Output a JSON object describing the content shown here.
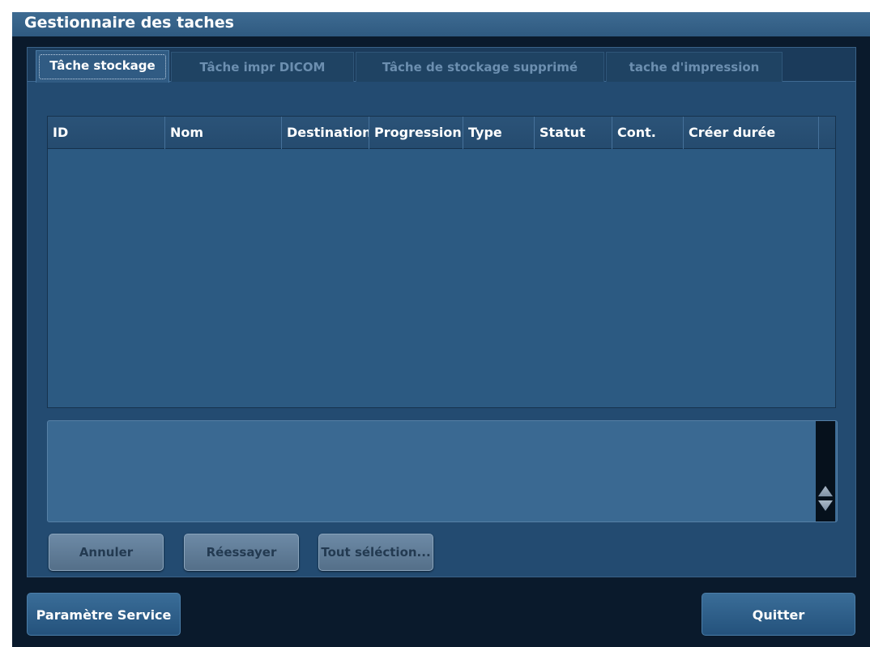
{
  "window": {
    "title": "Gestionnaire des taches"
  },
  "tabs": [
    {
      "label": "Tâche stockage",
      "active": true
    },
    {
      "label": "Tâche impr DICOM",
      "active": false
    },
    {
      "label": "Tâche de stockage supprimé",
      "active": false
    },
    {
      "label": "tache d'impression",
      "active": false
    }
  ],
  "table": {
    "columns": [
      "ID",
      "Nom",
      "Destination",
      "Progression",
      "Type",
      "Statut",
      "Cont.",
      "Créer durée"
    ],
    "rows": []
  },
  "log_box": {
    "text": ""
  },
  "actions": {
    "cancel_label": "Annuler",
    "retry_label": "Réessayer",
    "select_all_label": "Tout séléction..."
  },
  "footer": {
    "service_label": "Paramètre Service",
    "quit_label": "Quitter"
  },
  "colors": {
    "background": "#0a1a2c",
    "panel": "#234b71",
    "title_bar": "#3a678e",
    "table_body": "#2c5a82"
  }
}
